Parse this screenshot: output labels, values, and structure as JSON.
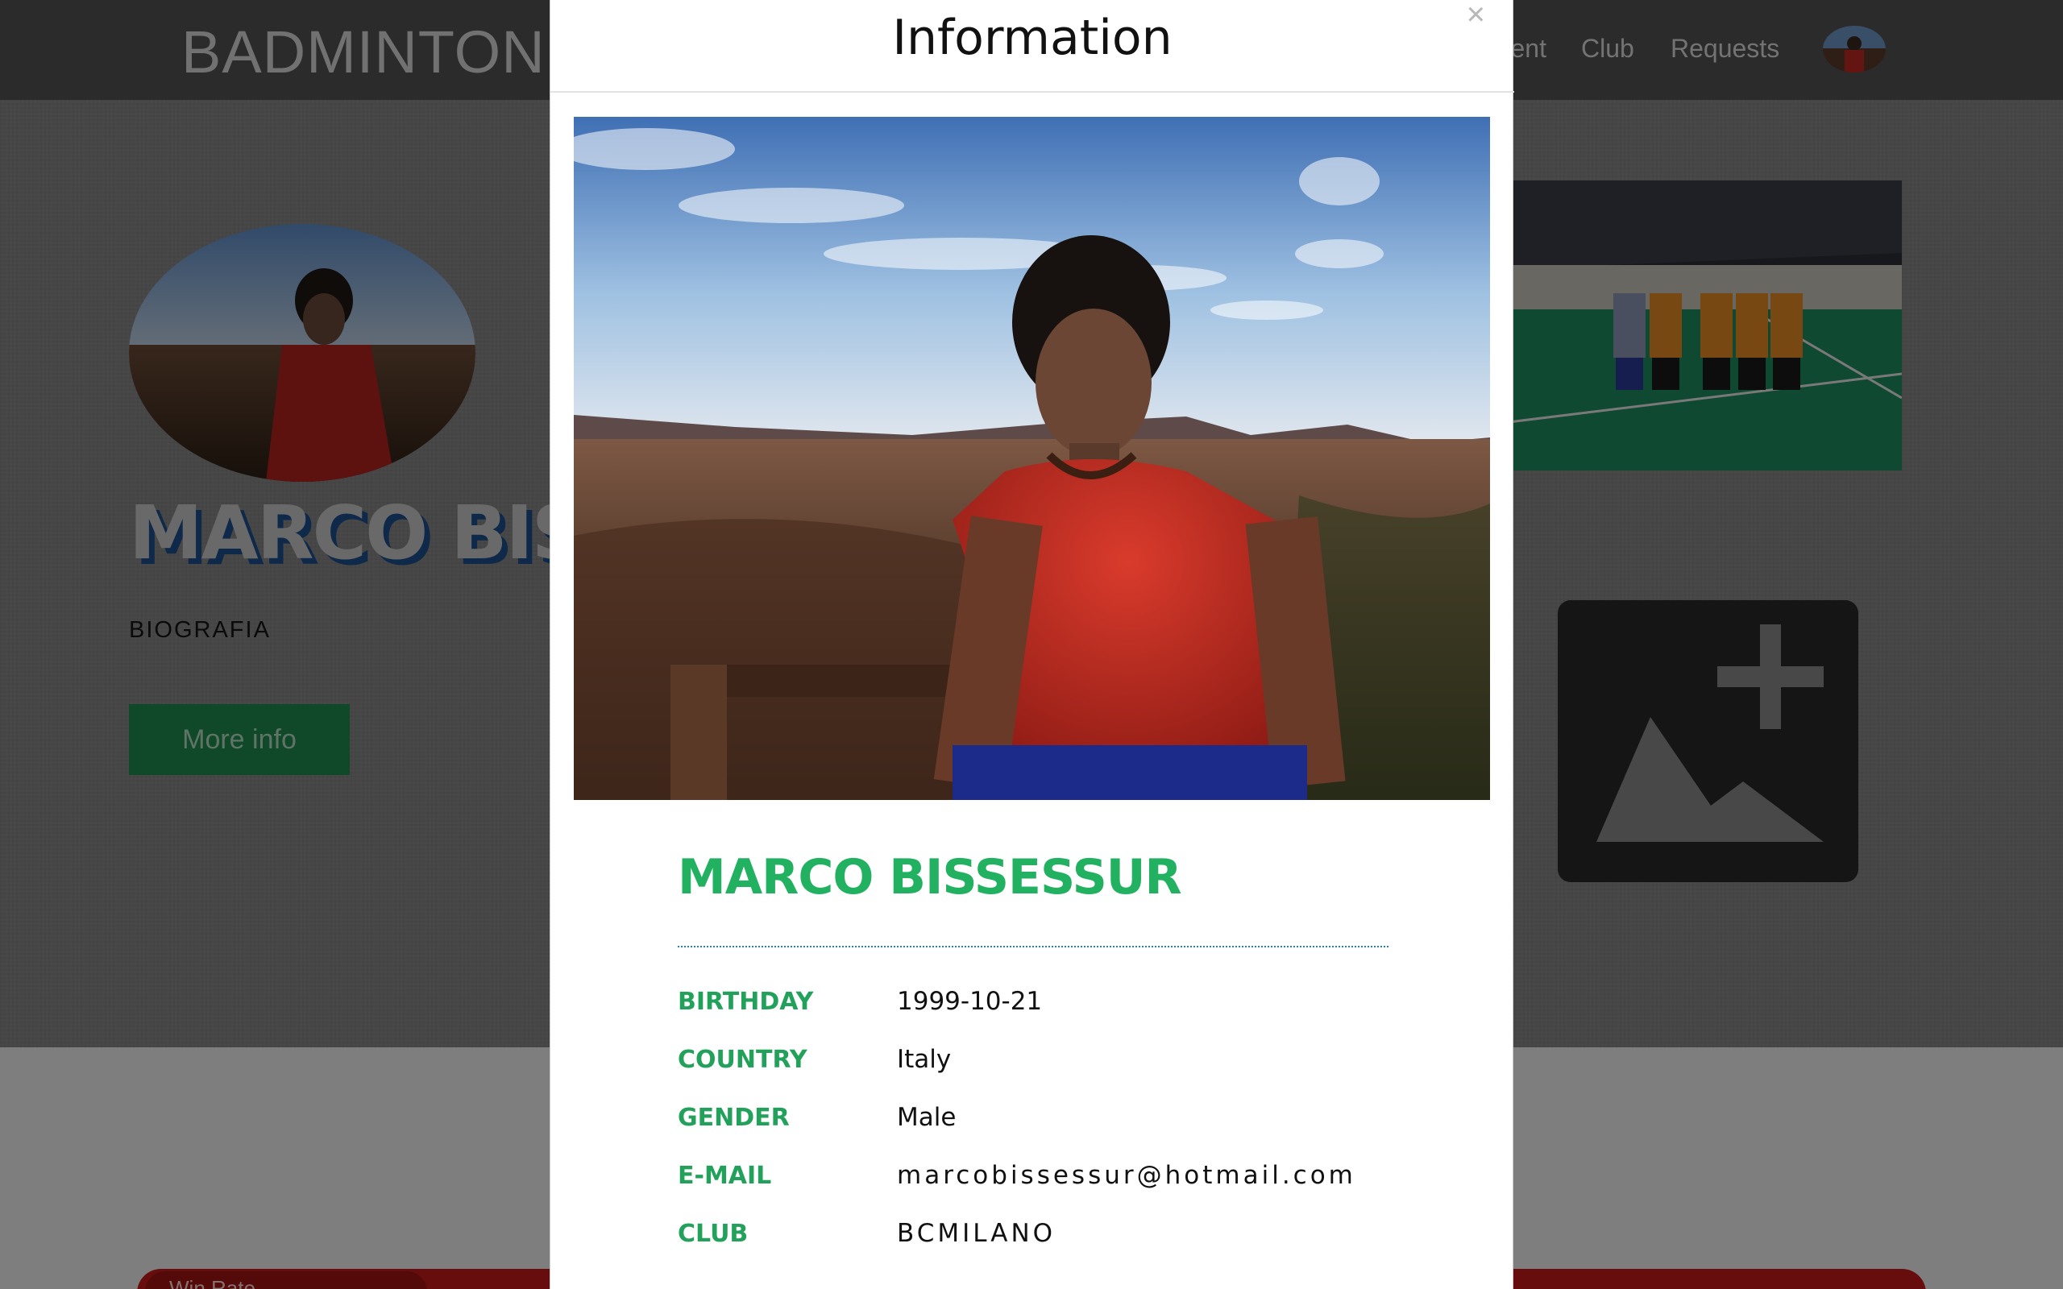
{
  "nav": {
    "brand": "BADMINTON CLUB",
    "links": [
      "Tournament",
      "Club",
      "Requests"
    ]
  },
  "profile": {
    "name": "MARCO BISSESSUR",
    "bio_label": "BIOGRAFIA",
    "more_info_label": "More info"
  },
  "bottom_bar": {
    "tab_label": "Win Rate"
  },
  "modal": {
    "title": "Information",
    "close_label": "×",
    "name": "MARCO BISSESSUR",
    "fields": [
      {
        "label": "BIRTHDAY",
        "value": "1999-10-21"
      },
      {
        "label": "COUNTRY",
        "value": "Italy"
      },
      {
        "label": "GENDER",
        "value": "Male"
      },
      {
        "label": "E-MAIL",
        "value": "marcobissessur@hotmail.com"
      },
      {
        "label": "CLUB",
        "value": "BCMILANO"
      }
    ]
  },
  "colors": {
    "accent_green": "#22b160",
    "button_green": "#1f8d4f",
    "nav_gray": "#545454",
    "bar_red": "#c51a1a"
  },
  "icons": {
    "close": "close-icon",
    "add_photo": "add-photo-icon"
  }
}
